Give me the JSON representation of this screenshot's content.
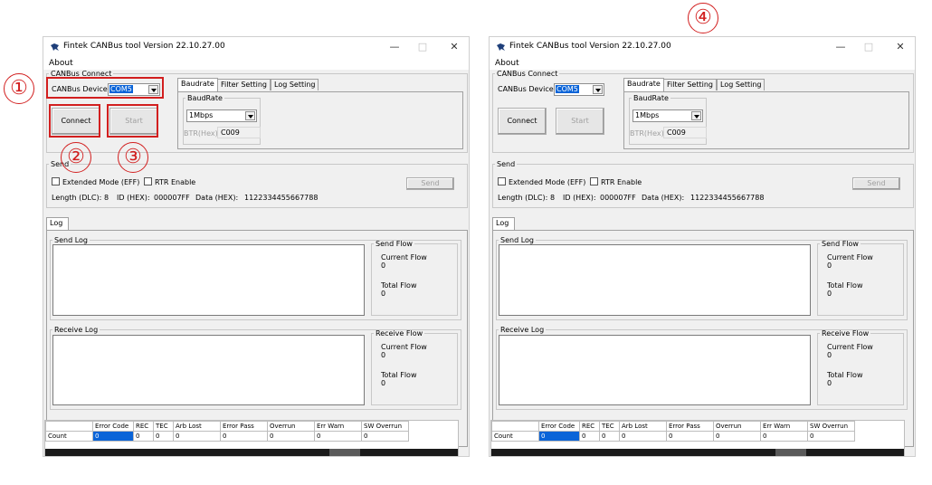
{
  "annotations": {
    "c1": "①",
    "c2": "②",
    "c3": "③",
    "c4": "④"
  },
  "colors": {
    "annotation_red": "#d21f1f",
    "selection_blue": "#0a64d8"
  },
  "window": {
    "title": "Fintek CANBus tool Version 22.10.27.00",
    "menu_about": "About",
    "min_glyph": "—",
    "max_glyph": "□",
    "close_glyph": "✕",
    "canbus_connect": "CANBus Connect",
    "canbus_device_label": "CANBus Device",
    "canbus_device_value": "COM5",
    "connect": "Connect",
    "start": "Start",
    "tabs": [
      "Baudrate",
      "Filter Setting",
      "Log Setting"
    ],
    "baudrate_group": "BaudRate",
    "baudrate_value": "1Mbps",
    "btr_label": "BTR(Hex)",
    "btr_value": "C009",
    "send_group": "Send",
    "extended_mode": "Extended Mode (EFF)",
    "rtr_enable": "RTR Enable",
    "send_button": "Send",
    "length_label": "Length (DLC):",
    "length_value": "8",
    "id_label": "ID (HEX):",
    "id_value": "000007FF",
    "data_label": "Data (HEX):",
    "data_value": "1122334455667788",
    "log_tab": "Log",
    "send_log": "Send Log",
    "send_flow": "Send Flow",
    "receive_log": "Receive Log",
    "receive_flow": "Receive Flow",
    "current_flow": "Current Flow",
    "total_flow": "Total Flow",
    "send_current_value": "0",
    "send_total_value": "0",
    "recv_current_value": "0",
    "recv_total_value": "0",
    "grid_headers": [
      "Error Code",
      "REC",
      "TEC",
      "Arb Lost",
      "Error Pass",
      "Overrun",
      "Err Warn",
      "SW Overrun"
    ],
    "grid_row_label": "Count",
    "grid_values": [
      "0",
      "0",
      "0",
      "0",
      "0",
      "0",
      "0",
      "0"
    ]
  }
}
